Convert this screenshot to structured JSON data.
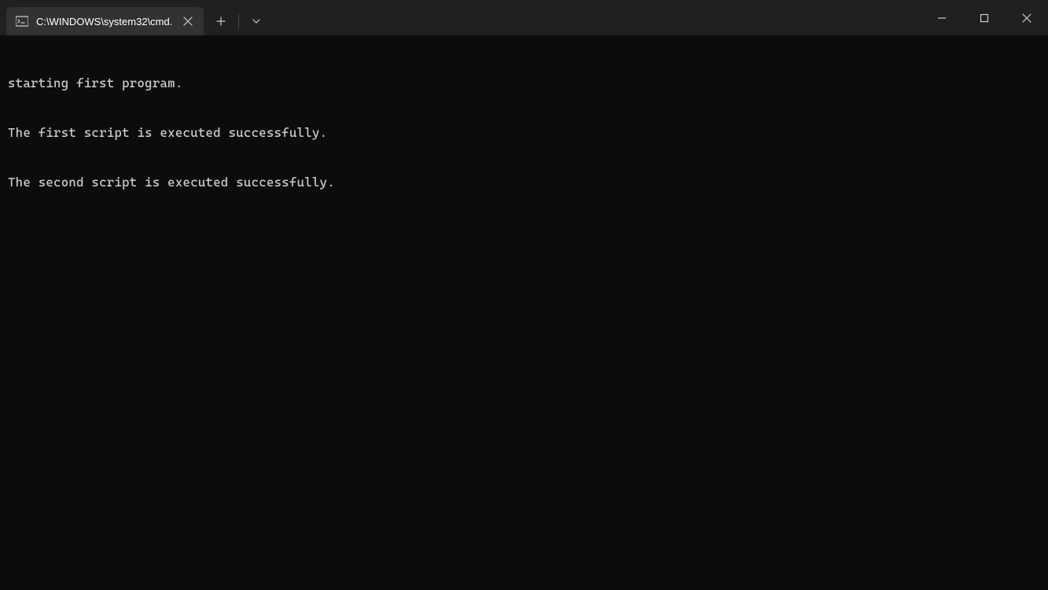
{
  "tab": {
    "title": "C:\\WINDOWS\\system32\\cmd."
  },
  "terminal": {
    "lines": [
      "starting first program.",
      "The first script is executed successfully.",
      "The second script is executed successfully."
    ]
  }
}
